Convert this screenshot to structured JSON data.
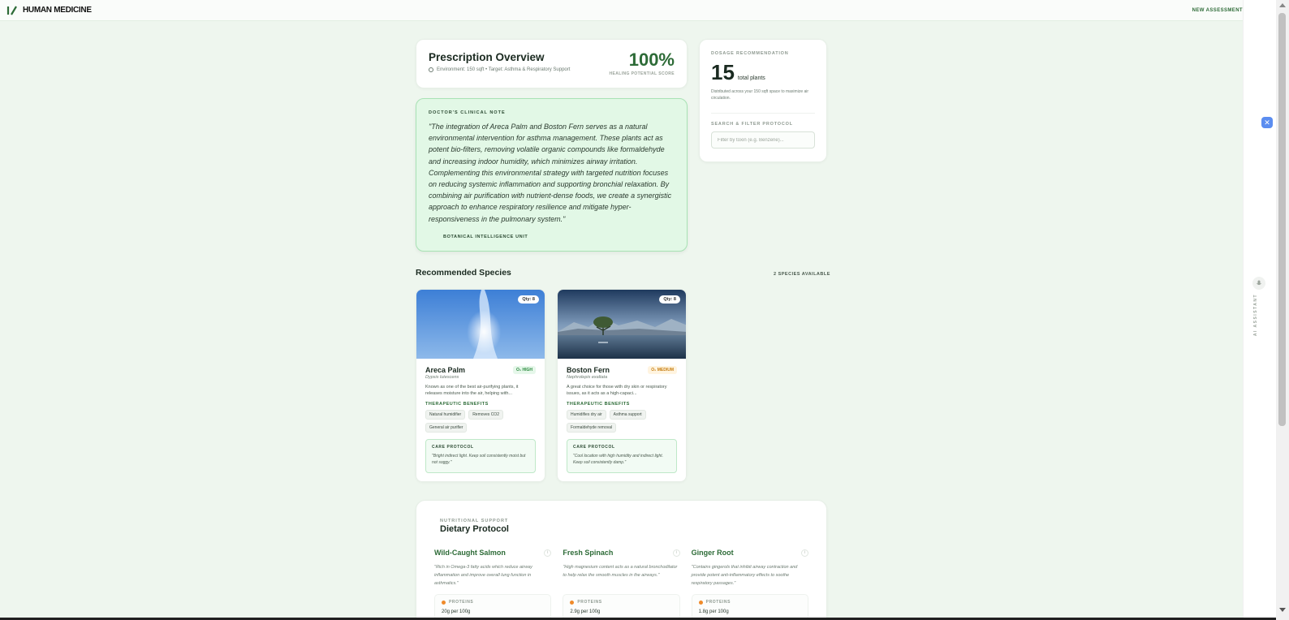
{
  "header": {
    "brand": "HUMAN MEDICINE",
    "new_assessment": "NEW ASSESSMENT"
  },
  "overview": {
    "title": "Prescription Overview",
    "subtitle": "Environment: 150 sqft • Target: Asthma & Respiratory Support",
    "score": "100%",
    "score_label": "HEALING POTENTIAL SCORE"
  },
  "note": {
    "label": "DOCTOR'S CLINICAL NOTE",
    "text": "\"The integration of Areca Palm and Boston Fern serves as a natural environmental intervention for asthma management. These plants act as potent bio-filters, removing volatile organic compounds like formaldehyde and increasing indoor humidity, which minimizes airway irritation. Complementing this environmental strategy with targeted nutrition focuses on reducing systemic inflammation and supporting bronchial relaxation. By combining air purification with nutrient-dense foods, we create a synergistic approach to enhance respiratory resilience and mitigate hyper-responsiveness in the pulmonary system.\"",
    "signature": "BOTANICAL INTELLIGENCE UNIT"
  },
  "dosage": {
    "label": "DOSAGE RECOMMENDATION",
    "count": "15",
    "unit": "total plants",
    "description": "Distributed across your 150 sqft space to maximize air circulation.",
    "filter_label": "SEARCH & FILTER PROTOCOL",
    "filter_placeholder": "Filter by toxin (e.g. Benzene)..."
  },
  "species_section": {
    "title": "Recommended Species",
    "count": "2 SPECIES AVAILABLE",
    "items": [
      {
        "qty": "Qty: 8",
        "name": "Areca Palm",
        "badge": "O₂ HIGH",
        "scientific": "Dypsis lutescens",
        "description": "Known as one of the best air-purifying plants, it releases moisture into the air, helping with...",
        "benefits_label": "THERAPEUTIC BENEFITS",
        "benefits": [
          "Natural humidifier",
          "Removes CO2",
          "General air purifier"
        ],
        "care_label": "CARE PROTOCOL",
        "care_text": "\"Bright indirect light. Keep soil consistently moist but not soggy.\""
      },
      {
        "qty": "Qty: 8",
        "name": "Boston Fern",
        "badge": "O₂ MEDIUM",
        "scientific": "Nephrolepis exaltata",
        "description": "A great choice for those with dry skin or respiratory issues, as it acts as a high-capaci...",
        "benefits_label": "THERAPEUTIC BENEFITS",
        "benefits": [
          "Humidifies dry air",
          "Asthma support",
          "Formaldehyde removal"
        ],
        "care_label": "CARE PROTOCOL",
        "care_text": "\"Cool location with high humidity and indirect light. Keep soil consistently damp.\""
      }
    ]
  },
  "diet": {
    "kicker": "NUTRITIONAL SUPPORT",
    "title": "Dietary Protocol",
    "foods": [
      {
        "name": "Wild-Caught Salmon",
        "description": "\"Rich in Omega-3 fatty acids which reduce airway inflammation and improve overall lung function in asthmatics.\"",
        "nutrient_label": "PROTEINS",
        "nutrient_value": "20g per 100g"
      },
      {
        "name": "Fresh Spinach",
        "description": "\"High magnesium content acts as a natural bronchodilator to help relax the smooth muscles in the airways.\"",
        "nutrient_label": "PROTEINS",
        "nutrient_value": "2.9g per 100g"
      },
      {
        "name": "Ginger Root",
        "description": "\"Contains gingerols that inhibit airway contraction and provide potent anti-inflammatory effects to soothe respiratory passages.\"",
        "nutrient_label": "PROTEINS",
        "nutrient_value": "1.8g per 100g"
      }
    ]
  },
  "assistant": {
    "label": "AI ASSISTANT"
  },
  "colors": {
    "accent": "#2d6b37",
    "background": "#eef6ee",
    "note_bg": "#e2f8e6"
  }
}
